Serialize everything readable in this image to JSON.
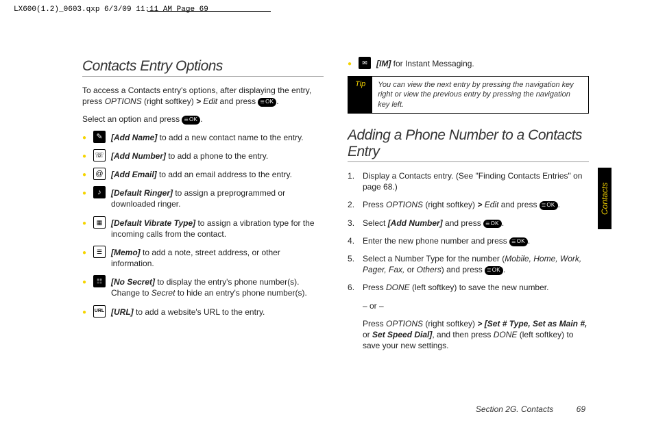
{
  "print_header": "LX600(1.2)_0603.qxp  6/3/09  11:11 AM  Page 69",
  "side_tab": "Contacts",
  "footer": {
    "section": "Section 2G. Contacts",
    "page": "69"
  },
  "left": {
    "heading": "Contacts Entry Options",
    "intro_a": "To access a Contacts entry's options, after displaying the entry, press ",
    "options": "OPTIONS",
    "intro_b": " (right softkey) ",
    "gt": ">",
    "edit": "Edit",
    "intro_c": " and press ",
    "select_line_a": "Select an option and press ",
    "items": [
      {
        "icon": "name",
        "label": "[Add Name]",
        "rest": " to add a new contact name to the entry."
      },
      {
        "icon": "num",
        "label": "[Add Number]",
        "rest": " to add a phone to the entry."
      },
      {
        "icon": "mail",
        "label": "[Add Email]",
        "rest": " to add an email address to the entry."
      },
      {
        "icon": "ring",
        "label": "[Default Ringer]",
        "rest": " to assign a preprogrammed or downloaded ringer."
      },
      {
        "icon": "vibe",
        "label": "[Default Vibrate Type]",
        "rest": " to assign a vibration type for the incoming calls from the contact."
      },
      {
        "icon": "memo",
        "label": "[Memo]",
        "rest": " to add a note, street address, or other information."
      },
      {
        "icon": "secret",
        "label": "[No Secret]",
        "rest": " to display the entry's phone number(s). Change to ",
        "extra_i": "Secret",
        "rest2": " to hide an entry's phone number(s)."
      },
      {
        "icon": "url",
        "label": "[URL]",
        "rest": " to add a website's URL to the entry."
      }
    ]
  },
  "right": {
    "im_label": "[IM]",
    "im_rest": " for Instant Messaging.",
    "tip_label": "Tip",
    "tip_text": "You can view the next entry by pressing the navigation key right or view the previous entry by pressing the navigation key left.",
    "heading": "Adding a Phone Number to a Contacts Entry",
    "steps": {
      "s1": "Display a Contacts entry. (See \"Finding Contacts Entries\" on page 68.)",
      "s2a": "Press ",
      "s2_opt": "OPTIONS",
      "s2b": " (right softkey) ",
      "s2_gt": ">",
      "s2_edit": "Edit",
      "s2c": "  and press ",
      "s3a": "Select ",
      "s3_lbl": "[Add Number]",
      "s3b": " and press ",
      "s4a": "Enter the new phone number and press ",
      "s5a": "Select a Number Type for the number (",
      "s5_types": "Mobile, Home, Work, Pager, Fax,",
      "s5b": " or ",
      "s5_oth": "Others",
      "s5c": ") and press ",
      "s6a": "Press ",
      "s6_done": "DONE",
      "s6b": " (left softkey) to save the new number."
    },
    "or": "– or –",
    "alt_a": "Press ",
    "alt_opt": "OPTIONS",
    "alt_b": " (right softkey) ",
    "alt_gt": ">",
    "alt_set": "[Set # Type, Set as Main #,",
    "alt_c": " or ",
    "alt_speed": "Set Speed Dial]",
    "alt_d": ",  and then press ",
    "alt_done": "DONE",
    "alt_e": " (left softkey) to save your new settings."
  }
}
